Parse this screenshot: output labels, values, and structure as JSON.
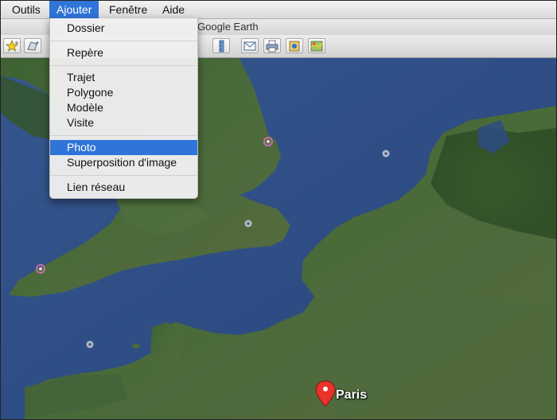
{
  "menubar": {
    "items": [
      "Outils",
      "Ajouter",
      "Fenêtre",
      "Aide"
    ]
  },
  "window": {
    "title": "Google Earth"
  },
  "dropdown": {
    "items": [
      "Dossier",
      "Repère",
      "Trajet",
      "Polygone",
      "Modèle",
      "Visite",
      "Photo",
      "Superposition d'image",
      "Lien réseau"
    ],
    "highlighted": "Photo"
  },
  "toolbar": {
    "icons": [
      "placemark-icon",
      "polygon-icon",
      "ruler-icon",
      "email-icon",
      "print-icon",
      "save-image-icon",
      "view-in-maps-icon"
    ]
  },
  "map": {
    "place_label": "Paris"
  },
  "colors": {
    "menu_highlight": "#2f74d8",
    "sea": "#2d4f86",
    "land": "#3a5a2f",
    "pin": "#e8332a"
  }
}
